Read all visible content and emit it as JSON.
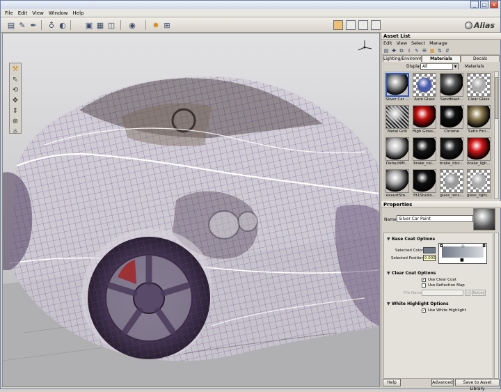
{
  "menus": [
    "File",
    "Edit",
    "View",
    "Window",
    "Help"
  ],
  "logo": "Alias",
  "asset_list": {
    "title": "Asset List",
    "menus": [
      "Edit",
      "View",
      "Select",
      "Manage"
    ],
    "tabs": [
      "Lighting/Environment",
      "Materials",
      "Decals"
    ],
    "display_label": "Display",
    "display_value": "All",
    "materials_label": "Materials",
    "swatches": [
      {
        "label": "Silver Car ...",
        "color": "#9a9a9a",
        "style": "sphere"
      },
      {
        "label": "Auto Glass",
        "color": "#4a5aa8",
        "style": "check"
      },
      {
        "label": "Sandblast...",
        "color": "#5a5a5a",
        "style": "sphere"
      },
      {
        "label": "Clear Glass",
        "color": "#aaaaaa",
        "style": "check"
      },
      {
        "label": "Metal Grill",
        "color": "#8a8a8a",
        "style": "grill"
      },
      {
        "label": "High Gloss...",
        "color": "#c01010",
        "style": "sphere"
      },
      {
        "label": "Chrome",
        "color": "#101010",
        "style": "sphere"
      },
      {
        "label": "Satin Fini...",
        "color": "#8a7a50",
        "style": "sphere"
      },
      {
        "label": "DefaultMt...",
        "color": "#c0c0c0",
        "style": "sphere"
      },
      {
        "label": "brake_cal...",
        "color": "#151515",
        "style": "sphere"
      },
      {
        "label": "brake_disc...",
        "color": "#202020",
        "style": "sphere"
      },
      {
        "label": "brake_ligh...",
        "color": "#d01818",
        "style": "sphere"
      },
      {
        "label": "exaustSto...",
        "color": "#b0b0b0",
        "style": "sphere"
      },
      {
        "label": "flt1Studio...",
        "color": "#101010",
        "style": "sphere"
      },
      {
        "label": "glass_lens...",
        "color": "#999999",
        "style": "check"
      },
      {
        "label": "glass_light...",
        "color": "#aaaaaa",
        "style": "check"
      }
    ]
  },
  "properties": {
    "title": "Properties",
    "name_label": "Name",
    "name_value": "Silver Car Paint",
    "base_coat": {
      "title": "Base Coat Options",
      "selected_color_label": "Selected Color",
      "selected_color": "#6f7886",
      "selected_position_label": "Selected Position",
      "selected_position": "0.000"
    },
    "clear_coat": {
      "title": "Clear Coat Options",
      "use_clear_coat": "Use Clear Coat",
      "use_reflection_map": "Use Reflection Map",
      "file_name_label": "File Name",
      "reload_label": "Reload"
    },
    "white_highlight": {
      "title": "White Highlight Options",
      "use_white_highlight": "Use White Highlight"
    }
  },
  "buttons": {
    "help": "Help",
    "advanced": "Advanced",
    "save": "Save to Asset Library"
  }
}
